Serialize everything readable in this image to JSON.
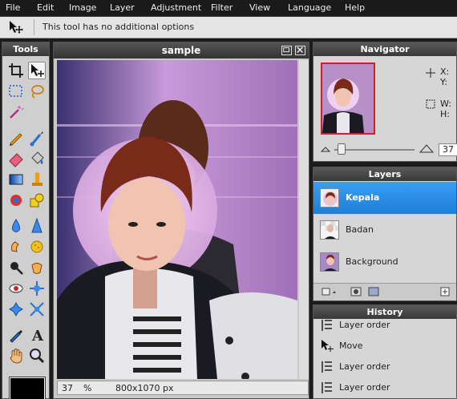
{
  "menu": [
    "File",
    "Edit",
    "Image",
    "Layer",
    "Adjustment",
    "Filter",
    "View",
    "Language",
    "Help"
  ],
  "options": {
    "message": "This tool has no additional options"
  },
  "tools_panel": {
    "title": "Tools"
  },
  "document": {
    "title": "sample",
    "zoom": "37",
    "zoom_unit": "%",
    "size": "800x1070 px"
  },
  "navigator": {
    "title": "Navigator",
    "x_label": "X:",
    "y_label": "Y:",
    "w_label": "W:",
    "h_label": "H:",
    "zoom_value": "37"
  },
  "layers": {
    "title": "Layers",
    "items": [
      {
        "name": "Kepala",
        "selected": true
      },
      {
        "name": "Badan",
        "selected": false
      },
      {
        "name": "Background",
        "selected": false
      }
    ]
  },
  "history": {
    "title": "History",
    "items": [
      "Layer order",
      "Move",
      "Layer order",
      "Layer order"
    ]
  },
  "colors": {
    "selected_layer": "#1d7fd8",
    "foreground": "#000000"
  }
}
